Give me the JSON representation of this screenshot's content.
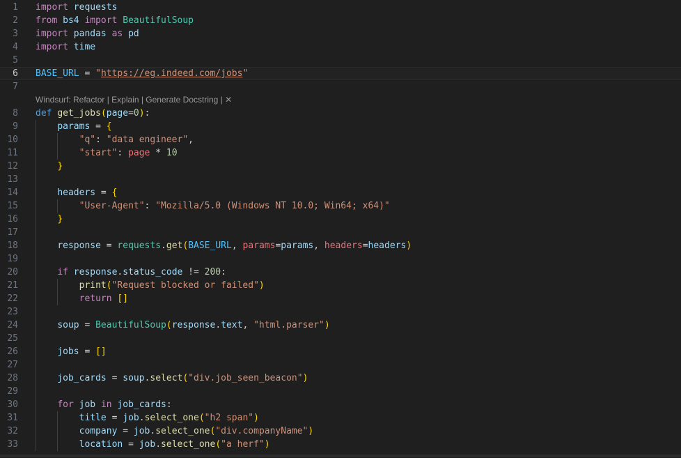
{
  "editor": {
    "current_line": 6,
    "code_lens": {
      "after_line": 7,
      "text": "Windsurf: Refactor | Explain | Generate Docstring | ✕"
    },
    "lines": [
      {
        "n": "1",
        "indent": 0,
        "tokens": [
          {
            "t": "import",
            "c": "kw"
          },
          {
            "t": " requests",
            "c": "var"
          }
        ]
      },
      {
        "n": "2",
        "indent": 0,
        "tokens": [
          {
            "t": "from",
            "c": "kw"
          },
          {
            "t": " bs4 ",
            "c": "var"
          },
          {
            "t": "import",
            "c": "kw"
          },
          {
            "t": " BeautifulSoup",
            "c": "cls"
          }
        ]
      },
      {
        "n": "3",
        "indent": 0,
        "tokens": [
          {
            "t": "import",
            "c": "kw"
          },
          {
            "t": " pandas ",
            "c": "var"
          },
          {
            "t": "as",
            "c": "kw"
          },
          {
            "t": " pd",
            "c": "var"
          }
        ]
      },
      {
        "n": "4",
        "indent": 0,
        "tokens": [
          {
            "t": "import",
            "c": "kw"
          },
          {
            "t": " time",
            "c": "var"
          }
        ]
      },
      {
        "n": "5",
        "indent": 0,
        "tokens": []
      },
      {
        "n": "6",
        "indent": 0,
        "tokens": [
          {
            "t": "BASE_URL",
            "c": "const"
          },
          {
            "t": " = ",
            "c": "op"
          },
          {
            "t": "\"",
            "c": "str"
          },
          {
            "t": "https://eg.indeed.com/jobs",
            "c": "link"
          },
          {
            "t": "\"",
            "c": "str"
          }
        ]
      },
      {
        "n": "7",
        "indent": 0,
        "tokens": []
      },
      {
        "n": "8",
        "indent": 0,
        "tokens": [
          {
            "t": "def",
            "c": "def"
          },
          {
            "t": " ",
            "c": "plain"
          },
          {
            "t": "get_jobs",
            "c": "fn"
          },
          {
            "t": "(",
            "c": "bracket"
          },
          {
            "t": "page",
            "c": "param"
          },
          {
            "t": "=",
            "c": "op"
          },
          {
            "t": "0",
            "c": "num"
          },
          {
            "t": ")",
            "c": "bracket"
          },
          {
            "t": ":",
            "c": "plain"
          }
        ]
      },
      {
        "n": "9",
        "indent": 1,
        "tokens": [
          {
            "t": "params",
            "c": "var"
          },
          {
            "t": " = ",
            "c": "op"
          },
          {
            "t": "{",
            "c": "bracket"
          }
        ]
      },
      {
        "n": "10",
        "indent": 2,
        "tokens": [
          {
            "t": "\"q\"",
            "c": "str"
          },
          {
            "t": ": ",
            "c": "plain"
          },
          {
            "t": "\"data engineer\"",
            "c": "str"
          },
          {
            "t": ",",
            "c": "plain"
          }
        ]
      },
      {
        "n": "11",
        "indent": 2,
        "tokens": [
          {
            "t": "\"start\"",
            "c": "str"
          },
          {
            "t": ": ",
            "c": "plain"
          },
          {
            "t": "page",
            "c": "kwarg"
          },
          {
            "t": " * ",
            "c": "op"
          },
          {
            "t": "10",
            "c": "num"
          }
        ]
      },
      {
        "n": "12",
        "indent": 1,
        "tokens": [
          {
            "t": "}",
            "c": "bracket"
          }
        ]
      },
      {
        "n": "13",
        "indent": 1,
        "tokens": []
      },
      {
        "n": "14",
        "indent": 1,
        "tokens": [
          {
            "t": "headers",
            "c": "var"
          },
          {
            "t": " = ",
            "c": "op"
          },
          {
            "t": "{",
            "c": "bracket"
          }
        ]
      },
      {
        "n": "15",
        "indent": 2,
        "tokens": [
          {
            "t": "\"User-Agent\"",
            "c": "str"
          },
          {
            "t": ": ",
            "c": "plain"
          },
          {
            "t": "\"Mozilla/5.0 (Windows NT 10.0; Win64; x64)\"",
            "c": "str"
          }
        ]
      },
      {
        "n": "16",
        "indent": 1,
        "tokens": [
          {
            "t": "}",
            "c": "bracket"
          }
        ]
      },
      {
        "n": "17",
        "indent": 1,
        "tokens": []
      },
      {
        "n": "18",
        "indent": 1,
        "tokens": [
          {
            "t": "response",
            "c": "var"
          },
          {
            "t": " = ",
            "c": "op"
          },
          {
            "t": "requests",
            "c": "cls"
          },
          {
            "t": ".",
            "c": "plain"
          },
          {
            "t": "get",
            "c": "fn"
          },
          {
            "t": "(",
            "c": "bracket"
          },
          {
            "t": "BASE_URL",
            "c": "const"
          },
          {
            "t": ", ",
            "c": "plain"
          },
          {
            "t": "params",
            "c": "kwarg"
          },
          {
            "t": "=",
            "c": "op"
          },
          {
            "t": "params",
            "c": "var"
          },
          {
            "t": ", ",
            "c": "plain"
          },
          {
            "t": "headers",
            "c": "kwarg"
          },
          {
            "t": "=",
            "c": "op"
          },
          {
            "t": "headers",
            "c": "var"
          },
          {
            "t": ")",
            "c": "bracket"
          }
        ]
      },
      {
        "n": "19",
        "indent": 1,
        "tokens": []
      },
      {
        "n": "20",
        "indent": 1,
        "tokens": [
          {
            "t": "if",
            "c": "kw"
          },
          {
            "t": " response",
            "c": "var"
          },
          {
            "t": ".",
            "c": "plain"
          },
          {
            "t": "status_code",
            "c": "var"
          },
          {
            "t": " != ",
            "c": "op"
          },
          {
            "t": "200",
            "c": "num"
          },
          {
            "t": ":",
            "c": "plain"
          }
        ]
      },
      {
        "n": "21",
        "indent": 2,
        "tokens": [
          {
            "t": "print",
            "c": "fn"
          },
          {
            "t": "(",
            "c": "bracket"
          },
          {
            "t": "\"Request blocked or failed\"",
            "c": "str"
          },
          {
            "t": ")",
            "c": "bracket"
          }
        ]
      },
      {
        "n": "22",
        "indent": 2,
        "tokens": [
          {
            "t": "return",
            "c": "kw"
          },
          {
            "t": " ",
            "c": "plain"
          },
          {
            "t": "[]",
            "c": "bracket"
          }
        ]
      },
      {
        "n": "23",
        "indent": 1,
        "tokens": []
      },
      {
        "n": "24",
        "indent": 1,
        "tokens": [
          {
            "t": "soup",
            "c": "var"
          },
          {
            "t": " = ",
            "c": "op"
          },
          {
            "t": "BeautifulSoup",
            "c": "cls"
          },
          {
            "t": "(",
            "c": "bracket"
          },
          {
            "t": "response",
            "c": "var"
          },
          {
            "t": ".",
            "c": "plain"
          },
          {
            "t": "text",
            "c": "var"
          },
          {
            "t": ", ",
            "c": "plain"
          },
          {
            "t": "\"html.parser\"",
            "c": "str"
          },
          {
            "t": ")",
            "c": "bracket"
          }
        ]
      },
      {
        "n": "25",
        "indent": 1,
        "tokens": []
      },
      {
        "n": "26",
        "indent": 1,
        "tokens": [
          {
            "t": "jobs",
            "c": "var"
          },
          {
            "t": " = ",
            "c": "op"
          },
          {
            "t": "[]",
            "c": "bracket"
          }
        ]
      },
      {
        "n": "27",
        "indent": 1,
        "tokens": []
      },
      {
        "n": "28",
        "indent": 1,
        "tokens": [
          {
            "t": "job_cards",
            "c": "var"
          },
          {
            "t": " = ",
            "c": "op"
          },
          {
            "t": "soup",
            "c": "var"
          },
          {
            "t": ".",
            "c": "plain"
          },
          {
            "t": "select",
            "c": "fn"
          },
          {
            "t": "(",
            "c": "bracket"
          },
          {
            "t": "\"div.job_seen_beacon\"",
            "c": "str"
          },
          {
            "t": ")",
            "c": "bracket"
          }
        ]
      },
      {
        "n": "29",
        "indent": 1,
        "tokens": []
      },
      {
        "n": "30",
        "indent": 1,
        "tokens": [
          {
            "t": "for",
            "c": "kw"
          },
          {
            "t": " job ",
            "c": "var"
          },
          {
            "t": "in",
            "c": "kw"
          },
          {
            "t": " job_cards",
            "c": "var"
          },
          {
            "t": ":",
            "c": "plain"
          }
        ]
      },
      {
        "n": "31",
        "indent": 2,
        "tokens": [
          {
            "t": "title",
            "c": "var"
          },
          {
            "t": " = ",
            "c": "op"
          },
          {
            "t": "job",
            "c": "var"
          },
          {
            "t": ".",
            "c": "plain"
          },
          {
            "t": "select_one",
            "c": "fn"
          },
          {
            "t": "(",
            "c": "bracket"
          },
          {
            "t": "\"h2 span\"",
            "c": "str"
          },
          {
            "t": ")",
            "c": "bracket"
          }
        ]
      },
      {
        "n": "32",
        "indent": 2,
        "tokens": [
          {
            "t": "company",
            "c": "var"
          },
          {
            "t": " = ",
            "c": "op"
          },
          {
            "t": "job",
            "c": "var"
          },
          {
            "t": ".",
            "c": "plain"
          },
          {
            "t": "select_one",
            "c": "fn"
          },
          {
            "t": "(",
            "c": "bracket"
          },
          {
            "t": "\"div.companyName\"",
            "c": "str"
          },
          {
            "t": ")",
            "c": "bracket"
          }
        ]
      },
      {
        "n": "33",
        "indent": 2,
        "tokens": [
          {
            "t": "location",
            "c": "var"
          },
          {
            "t": " = ",
            "c": "op"
          },
          {
            "t": "job",
            "c": "var"
          },
          {
            "t": ".",
            "c": "plain"
          },
          {
            "t": "select_one",
            "c": "fn"
          },
          {
            "t": "(",
            "c": "bracket"
          },
          {
            "t": "\"a herf\"",
            "c": "str"
          },
          {
            "t": ")",
            "c": "bracket"
          }
        ]
      }
    ]
  }
}
